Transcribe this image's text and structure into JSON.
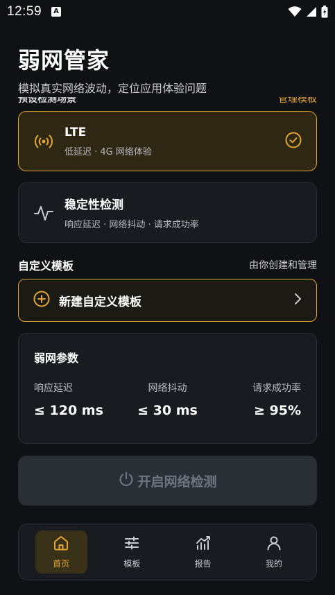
{
  "status": {
    "time": "12:59",
    "notif_glyph": "A"
  },
  "header": {
    "title": "弱网管家",
    "subtitle": "模拟真实网络波动，定位应用体验问题"
  },
  "strip": {
    "left": "预设检测场景",
    "right": "管理模板"
  },
  "cards": [
    {
      "title": "LTE",
      "desc": "低延迟 · 4G 网络体验",
      "icon": "broadcast-icon",
      "selected": true
    },
    {
      "title": "稳定性检测",
      "desc": "响应延迟 · 网络抖动 · 请求成功率",
      "icon": "pulse-icon",
      "selected": false
    }
  ],
  "custom": {
    "title": "自定义模板",
    "note": "由你创建和管理",
    "new_label": "新建自定义模板"
  },
  "params": {
    "title": "弱网参数",
    "items": [
      {
        "label": "响应延迟",
        "value": "≤ 120 ms"
      },
      {
        "label": "网络抖动",
        "value": "≤ 30 ms"
      },
      {
        "label": "请求成功率",
        "value": "≥ 95%"
      }
    ]
  },
  "start": {
    "label": "开启网络检测"
  },
  "nav": [
    {
      "label": "首页",
      "icon": "home-icon",
      "active": true
    },
    {
      "label": "模板",
      "icon": "sliders-icon",
      "active": false
    },
    {
      "label": "报告",
      "icon": "chart-icon",
      "active": false
    },
    {
      "label": "我的",
      "icon": "user-icon",
      "active": false
    }
  ],
  "colors": {
    "accent": "#e3a635",
    "background": "#0f1114",
    "card": "#181b20"
  }
}
